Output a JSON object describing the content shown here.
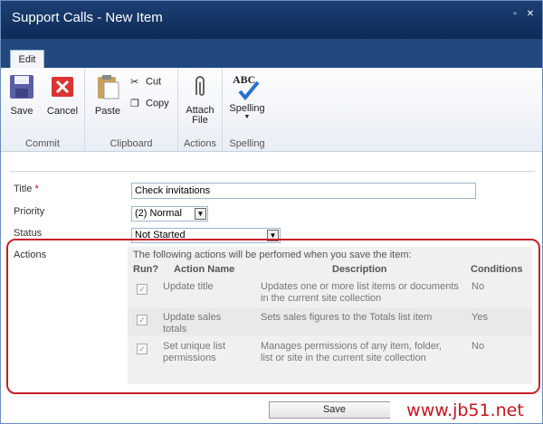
{
  "window": {
    "title": "Support Calls - New Item"
  },
  "ribbon": {
    "tab": "Edit",
    "groups": {
      "commit": {
        "label": "Commit",
        "save": "Save",
        "cancel": "Cancel"
      },
      "clipboard": {
        "label": "Clipboard",
        "paste": "Paste",
        "cut": "Cut",
        "copy": "Copy"
      },
      "actions": {
        "label": "Actions",
        "attach": "Attach",
        "attach2": "File"
      },
      "spelling": {
        "label": "Spelling",
        "spelling": "Spelling",
        "abc": "ABC"
      }
    }
  },
  "form": {
    "title_label": "Title",
    "title_value": "Check invitations",
    "priority_label": "Priority",
    "priority_value": "(2) Normal",
    "status_label": "Status",
    "status_value": "Not Started",
    "actions_label": "Actions",
    "actions_intro": "The following actions will be perfomed when you save the item:",
    "headers": {
      "run": "Run?",
      "name": "Action Name",
      "description": "Description",
      "conditions": "Conditions"
    },
    "rows": [
      {
        "name": "Update title",
        "description": "Updates one or more list items or documents in the current site collection",
        "conditions": "No"
      },
      {
        "name": "Update sales totals",
        "description": "Sets sales figures to the Totals list item",
        "conditions": "Yes"
      },
      {
        "name": "Set unique list permissions",
        "description": "Manages permissions of any item, folder, list or site in the current site collection",
        "conditions": "No"
      }
    ],
    "save_button": "Save"
  },
  "watermark": "www.jb51.net",
  "colors": {
    "title_bar": "#1c3f74",
    "highlight": "#c8202a",
    "required": "#cc0000"
  }
}
